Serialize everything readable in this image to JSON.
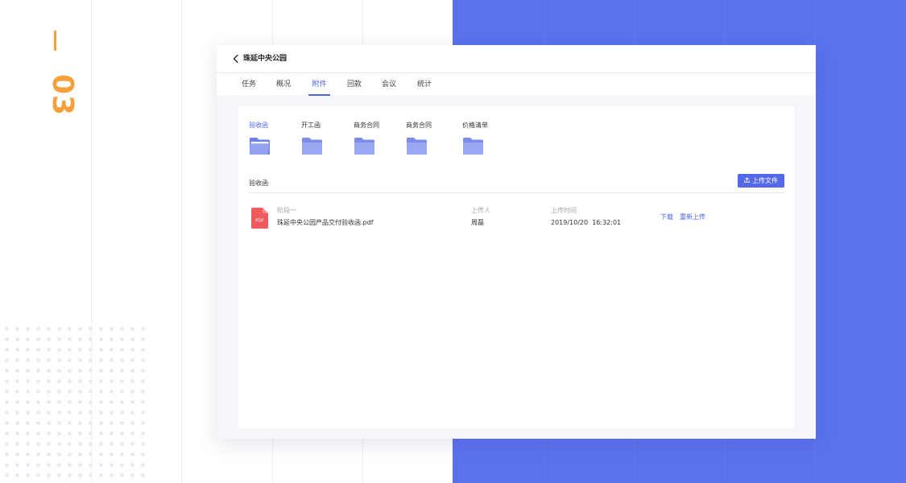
{
  "decoration": {
    "section_number": "03",
    "accent_color": "#f5a03a",
    "panel_color": "#5a72ee"
  },
  "header": {
    "back_icon": "chevron-left-icon",
    "title": "珠延中央公园"
  },
  "tabs": [
    {
      "label": "任务",
      "active": false
    },
    {
      "label": "概况",
      "active": false
    },
    {
      "label": "附件",
      "active": true
    },
    {
      "label": "回款",
      "active": false
    },
    {
      "label": "会议",
      "active": false
    },
    {
      "label": "统计",
      "active": false
    }
  ],
  "folders": [
    {
      "label": "验收函",
      "icon": "folder-open-icon",
      "active": true
    },
    {
      "label": "开工函",
      "icon": "folder-icon",
      "active": false
    },
    {
      "label": "商务合同",
      "icon": "folder-icon",
      "active": false
    },
    {
      "label": "商务合同",
      "icon": "folder-icon",
      "active": false
    },
    {
      "label": "价格清单",
      "icon": "folder-icon",
      "active": false
    }
  ],
  "section": {
    "title": "验收函",
    "upload_label": "上传文件",
    "upload_icon": "upload-icon"
  },
  "files": [
    {
      "icon": "pdf-icon",
      "icon_text": "PDF",
      "stage_label": "阶段一",
      "name": "珠延中央公园产品交付验收函.pdf",
      "uploader_label": "上传人",
      "uploader": "周磊",
      "time_label": "上传时间",
      "time": "2019/10/20  16:32:01",
      "actions": [
        "下载",
        "重新上传"
      ]
    }
  ],
  "colors": {
    "primary": "#4a63e8",
    "button": "#5468ea",
    "folder": "#8d9cf2",
    "pdf": "#ef5a5d"
  }
}
